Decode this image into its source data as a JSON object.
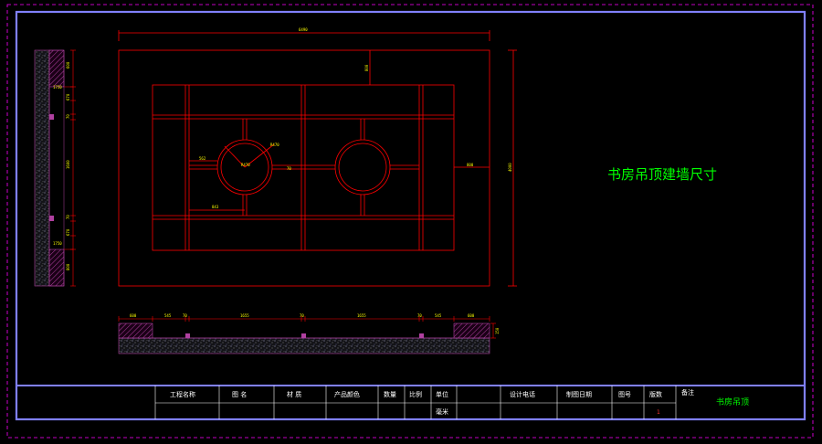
{
  "drawing": {
    "title": "书房吊顶建墙尺寸",
    "top_dims": {
      "overall": "6490",
      "upper_offset": "800",
      "right_offset": "800",
      "height": "4000"
    },
    "plan_dims": {
      "d1": "562",
      "d2": "R470",
      "d3": "R470",
      "d4": "843",
      "d5": "70"
    },
    "side_dims": [
      "600",
      "1750",
      "670",
      "70",
      "1600",
      "70",
      "670",
      "1750",
      "800"
    ],
    "section_dims": [
      "600",
      "545",
      "70",
      "1655",
      "70",
      "1655",
      "70",
      "545",
      "600"
    ],
    "section_height": "150"
  },
  "title_block": {
    "headers": [
      "工程名称",
      "图  名",
      "材  质",
      "产品颜色",
      "数量",
      "比例",
      "单位",
      "",
      "设计电话",
      "制图日期",
      "图号",
      "版数"
    ],
    "unit_value": "毫米",
    "version_value": "1",
    "remarks_label": "备注",
    "remarks_value": "书房吊顶"
  },
  "colors": {
    "border_blue": "#8080ff",
    "outer_magenta": "#ff00ff",
    "line_red": "#ff0000",
    "dim_yellow": "#ffff00",
    "title_green": "#00ff00",
    "hatch_purple": "#b040a0"
  }
}
